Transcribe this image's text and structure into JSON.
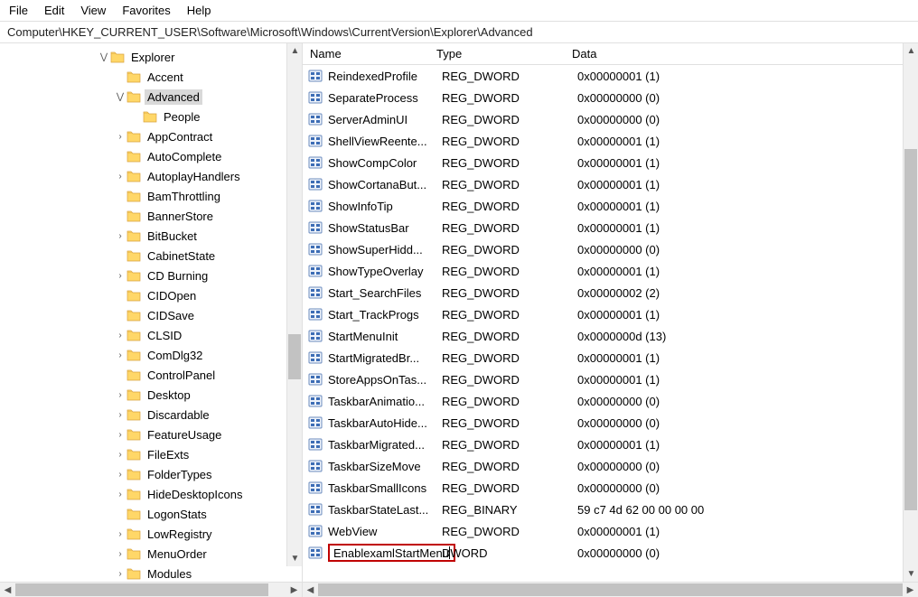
{
  "menu": [
    "File",
    "Edit",
    "View",
    "Favorites",
    "Help"
  ],
  "address": "Computer\\HKEY_CURRENT_USER\\Software\\Microsoft\\Windows\\CurrentVersion\\Explorer\\Advanced",
  "columns": {
    "name": "Name",
    "type": "Type",
    "data": "Data"
  },
  "tree": [
    {
      "depth": 6,
      "expand": "open",
      "label": "Explorer"
    },
    {
      "depth": 7,
      "expand": "none",
      "label": "Accent"
    },
    {
      "depth": 7,
      "expand": "open",
      "label": "Advanced",
      "selected": true
    },
    {
      "depth": 8,
      "expand": "none",
      "label": "People"
    },
    {
      "depth": 7,
      "expand": "closed",
      "label": "AppContract"
    },
    {
      "depth": 7,
      "expand": "none",
      "label": "AutoComplete"
    },
    {
      "depth": 7,
      "expand": "closed",
      "label": "AutoplayHandlers"
    },
    {
      "depth": 7,
      "expand": "none",
      "label": "BamThrottling"
    },
    {
      "depth": 7,
      "expand": "none",
      "label": "BannerStore"
    },
    {
      "depth": 7,
      "expand": "closed",
      "label": "BitBucket"
    },
    {
      "depth": 7,
      "expand": "none",
      "label": "CabinetState"
    },
    {
      "depth": 7,
      "expand": "closed",
      "label": "CD Burning"
    },
    {
      "depth": 7,
      "expand": "none",
      "label": "CIDOpen"
    },
    {
      "depth": 7,
      "expand": "none",
      "label": "CIDSave"
    },
    {
      "depth": 7,
      "expand": "closed",
      "label": "CLSID"
    },
    {
      "depth": 7,
      "expand": "closed",
      "label": "ComDlg32"
    },
    {
      "depth": 7,
      "expand": "none",
      "label": "ControlPanel"
    },
    {
      "depth": 7,
      "expand": "closed",
      "label": "Desktop"
    },
    {
      "depth": 7,
      "expand": "closed",
      "label": "Discardable"
    },
    {
      "depth": 7,
      "expand": "closed",
      "label": "FeatureUsage"
    },
    {
      "depth": 7,
      "expand": "closed",
      "label": "FileExts"
    },
    {
      "depth": 7,
      "expand": "closed",
      "label": "FolderTypes"
    },
    {
      "depth": 7,
      "expand": "closed",
      "label": "HideDesktopIcons"
    },
    {
      "depth": 7,
      "expand": "none",
      "label": "LogonStats"
    },
    {
      "depth": 7,
      "expand": "closed",
      "label": "LowRegistry"
    },
    {
      "depth": 7,
      "expand": "closed",
      "label": "MenuOrder"
    },
    {
      "depth": 7,
      "expand": "closed",
      "label": "Modules"
    }
  ],
  "values": [
    {
      "name": "ReindexedProfile",
      "type": "REG_DWORD",
      "data": "0x00000001 (1)"
    },
    {
      "name": "SeparateProcess",
      "type": "REG_DWORD",
      "data": "0x00000000 (0)"
    },
    {
      "name": "ServerAdminUI",
      "type": "REG_DWORD",
      "data": "0x00000000 (0)"
    },
    {
      "name": "ShellViewReente...",
      "type": "REG_DWORD",
      "data": "0x00000001 (1)"
    },
    {
      "name": "ShowCompColor",
      "type": "REG_DWORD",
      "data": "0x00000001 (1)"
    },
    {
      "name": "ShowCortanaBut...",
      "type": "REG_DWORD",
      "data": "0x00000001 (1)"
    },
    {
      "name": "ShowInfoTip",
      "type": "REG_DWORD",
      "data": "0x00000001 (1)"
    },
    {
      "name": "ShowStatusBar",
      "type": "REG_DWORD",
      "data": "0x00000001 (1)"
    },
    {
      "name": "ShowSuperHidd...",
      "type": "REG_DWORD",
      "data": "0x00000000 (0)"
    },
    {
      "name": "ShowTypeOverlay",
      "type": "REG_DWORD",
      "data": "0x00000001 (1)"
    },
    {
      "name": "Start_SearchFiles",
      "type": "REG_DWORD",
      "data": "0x00000002 (2)"
    },
    {
      "name": "Start_TrackProgs",
      "type": "REG_DWORD",
      "data": "0x00000001 (1)"
    },
    {
      "name": "StartMenuInit",
      "type": "REG_DWORD",
      "data": "0x0000000d (13)"
    },
    {
      "name": "StartMigratedBr...",
      "type": "REG_DWORD",
      "data": "0x00000001 (1)"
    },
    {
      "name": "StoreAppsOnTas...",
      "type": "REG_DWORD",
      "data": "0x00000001 (1)"
    },
    {
      "name": "TaskbarAnimatio...",
      "type": "REG_DWORD",
      "data": "0x00000000 (0)"
    },
    {
      "name": "TaskbarAutoHide...",
      "type": "REG_DWORD",
      "data": "0x00000000 (0)"
    },
    {
      "name": "TaskbarMigrated...",
      "type": "REG_DWORD",
      "data": "0x00000001 (1)"
    },
    {
      "name": "TaskbarSizeMove",
      "type": "REG_DWORD",
      "data": "0x00000000 (0)"
    },
    {
      "name": "TaskbarSmallIcons",
      "type": "REG_DWORD",
      "data": "0x00000000 (0)"
    },
    {
      "name": "TaskbarStateLast...",
      "type": "REG_BINARY",
      "data": "59 c7 4d 62 00 00 00 00"
    },
    {
      "name": "WebView",
      "type": "REG_DWORD",
      "data": "0x00000001 (1)"
    },
    {
      "name": "EnablexamlStartMenu",
      "type": "DWORD",
      "data": "0x00000000 (0)",
      "editing": true
    }
  ]
}
